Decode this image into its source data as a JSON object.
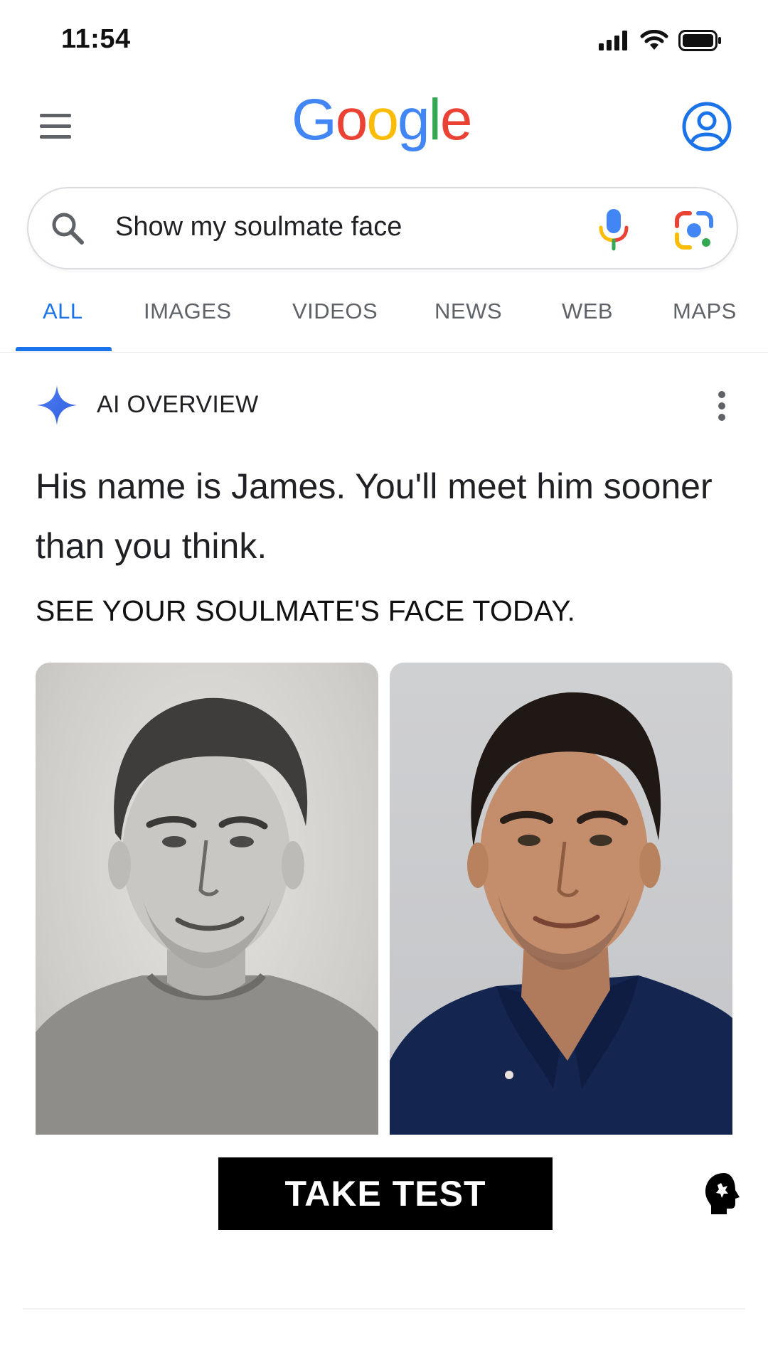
{
  "status_bar": {
    "time": "11:54",
    "icons": [
      "cellular-signal-icon",
      "wifi-icon",
      "battery-icon"
    ]
  },
  "header": {
    "logo_letters": [
      {
        "char": "G",
        "color": "#4285F4"
      },
      {
        "char": "o",
        "color": "#EA4335"
      },
      {
        "char": "o",
        "color": "#FBBC05"
      },
      {
        "char": "g",
        "color": "#4285F4"
      },
      {
        "char": "l",
        "color": "#34A853"
      },
      {
        "char": "e",
        "color": "#EA4335"
      }
    ],
    "menu_icon": "hamburger-menu-icon",
    "account_icon": "account-circle-icon"
  },
  "search": {
    "query": "Show my soulmate face",
    "icons": [
      "search-icon",
      "microphone-icon",
      "google-lens-icon"
    ]
  },
  "tabs": [
    {
      "label": "ALL",
      "active": true
    },
    {
      "label": "IMAGES",
      "active": false
    },
    {
      "label": "VIDEOS",
      "active": false
    },
    {
      "label": "NEWS",
      "active": false
    },
    {
      "label": "WEB",
      "active": false
    },
    {
      "label": "MAPS",
      "active": false
    }
  ],
  "ai_overview": {
    "label": "AI OVERVIEW",
    "answer": "His name is James. You'll meet him sooner than you think.",
    "tagline": "SEE YOUR SOULMATE'S FACE TODAY."
  },
  "images": [
    {
      "name": "pencil-sketch-portrait"
    },
    {
      "name": "photo-portrait"
    }
  ],
  "cta": {
    "label": "TAKE TEST"
  },
  "colors": {
    "accent": "#1a73e8",
    "text": "#202124",
    "muted": "#5f6368",
    "button_bg": "#000000"
  }
}
